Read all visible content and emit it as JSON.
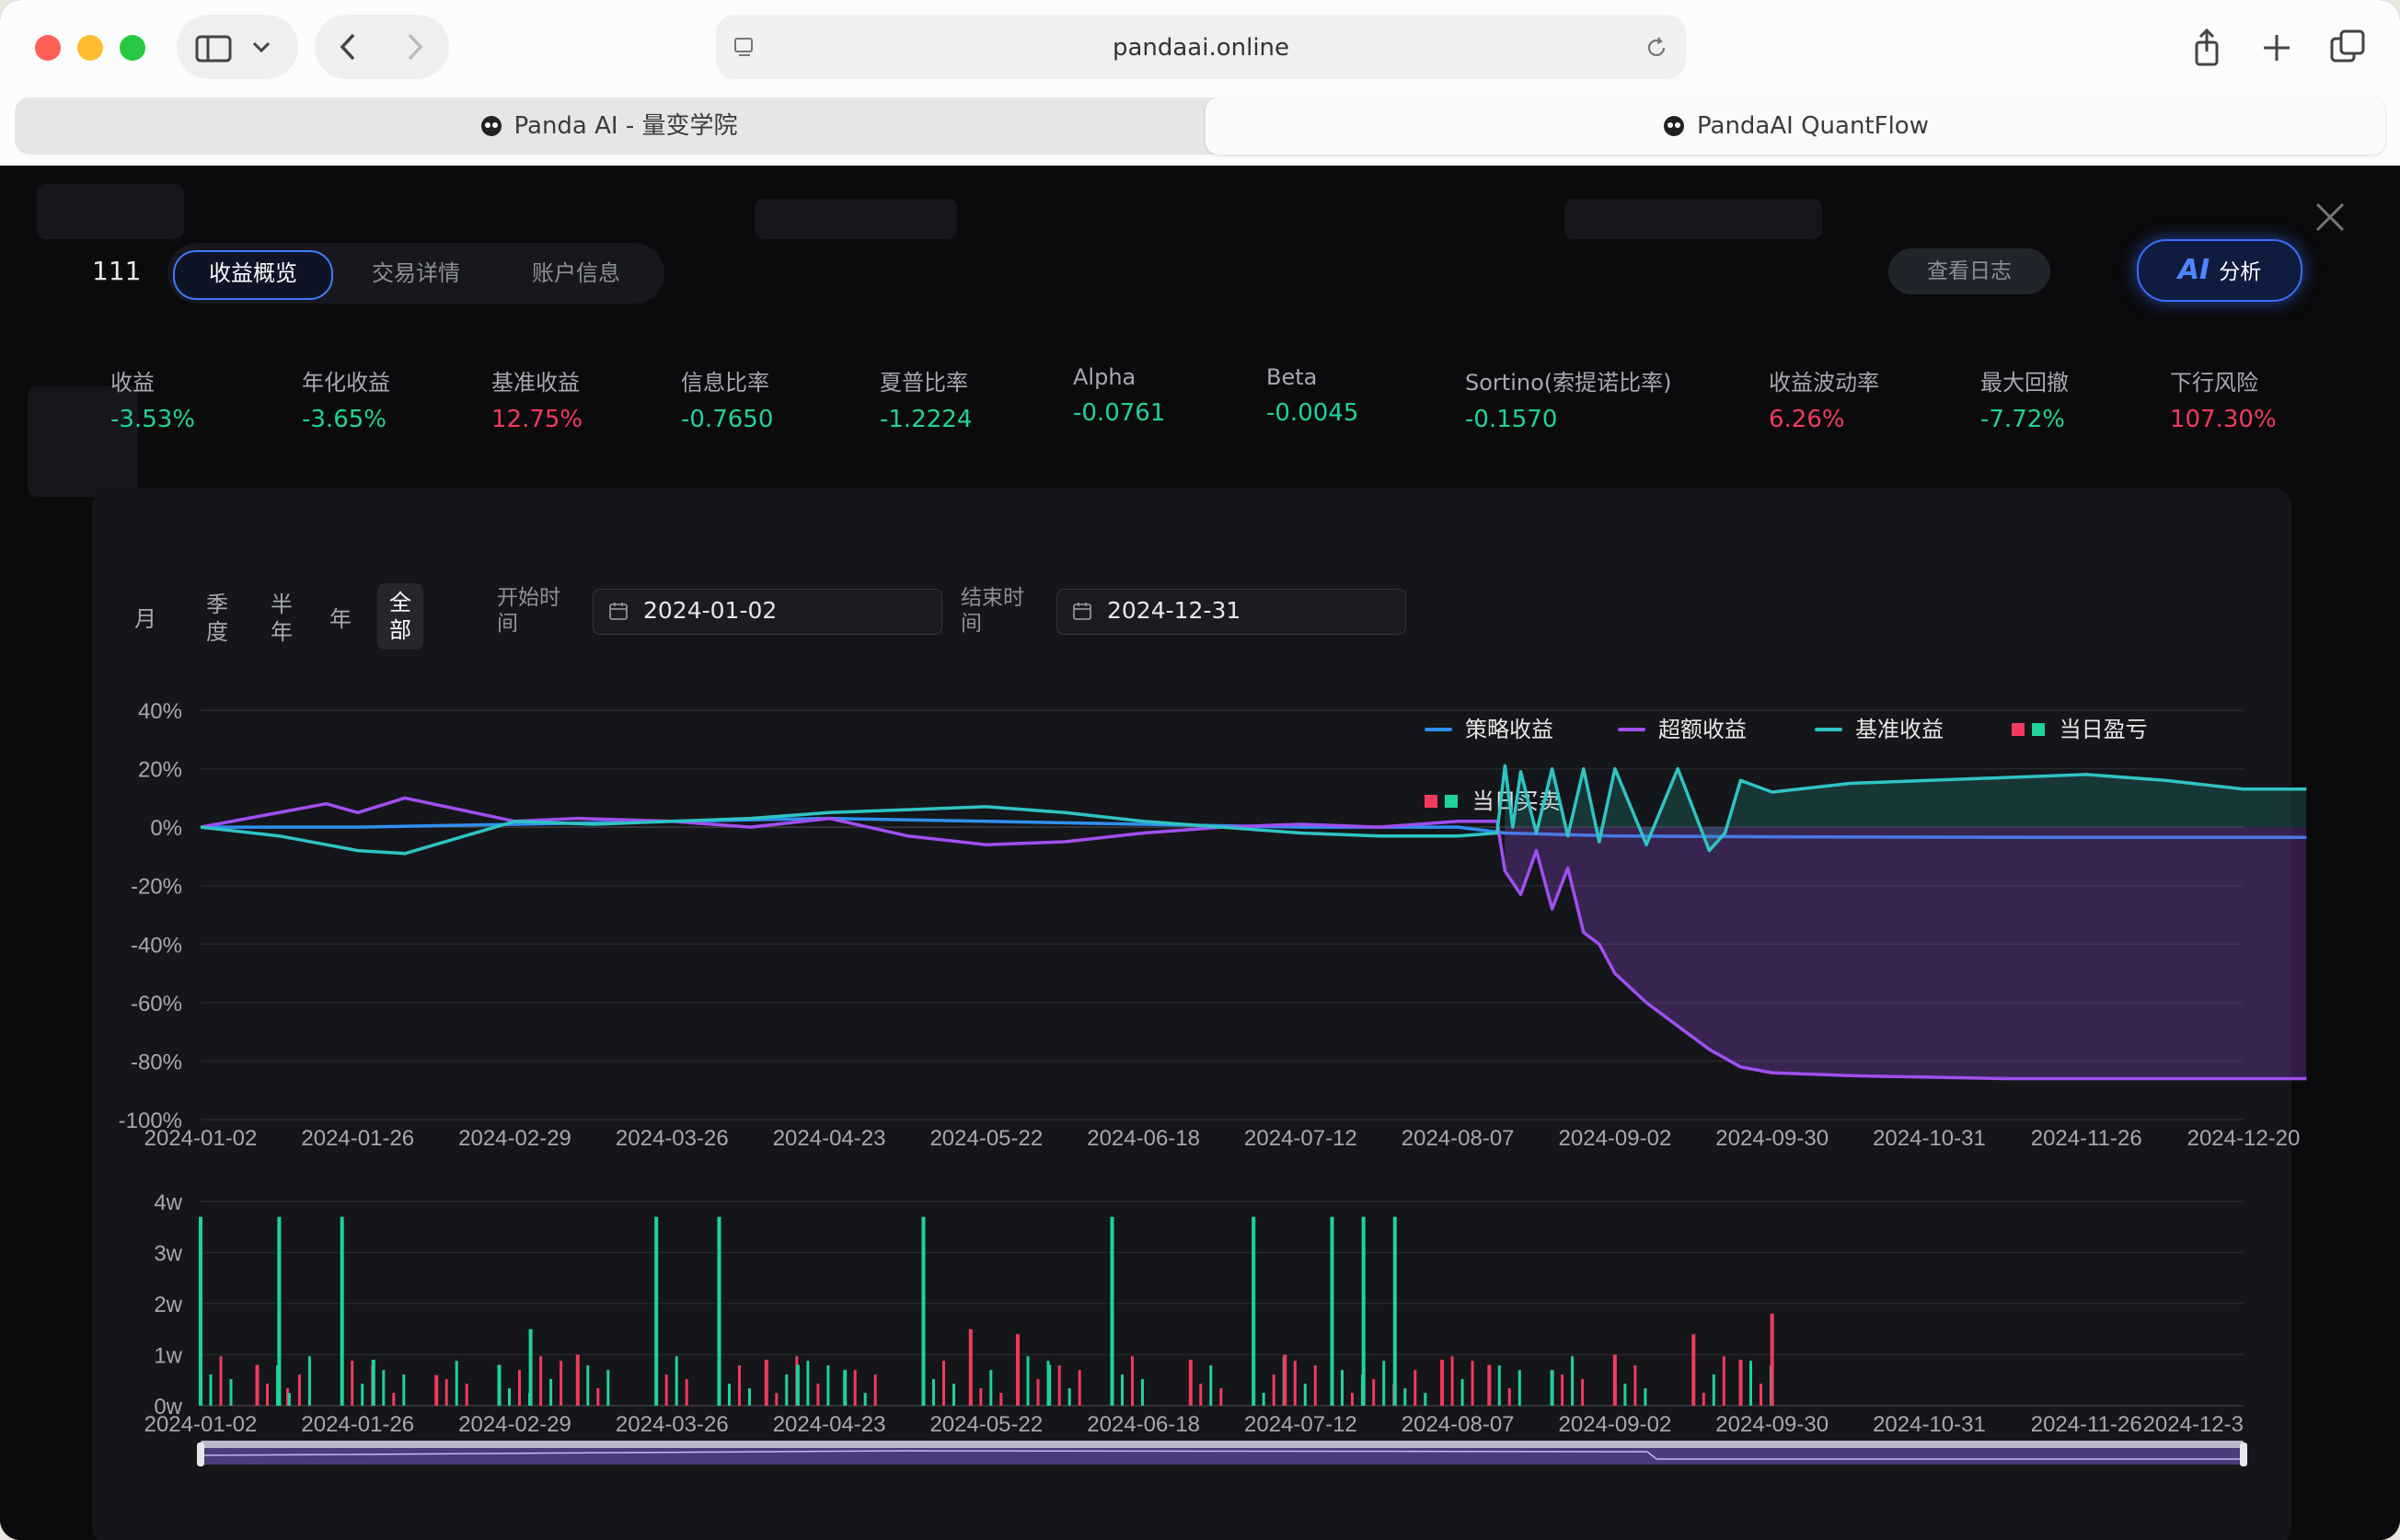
{
  "browser": {
    "url": "pandaai.online",
    "tabs": [
      {
        "label": "Panda AI - 量变学院",
        "active": false
      },
      {
        "label": "PandaAI QuantFlow",
        "active": true
      }
    ]
  },
  "header": {
    "name": "111",
    "tabs": [
      "收益概览",
      "交易详情",
      "账户信息"
    ],
    "active_tab": 0,
    "log_button": "查看日志",
    "ai_button": {
      "mark": "AI",
      "label": "分析"
    }
  },
  "metrics": [
    {
      "label": "收益",
      "value": "-3.53%",
      "tone": "green"
    },
    {
      "label": "年化收益",
      "value": "-3.65%",
      "tone": "green"
    },
    {
      "label": "基准收益",
      "value": "12.75%",
      "tone": "red"
    },
    {
      "label": "信息比率",
      "value": "-0.7650",
      "tone": "green"
    },
    {
      "label": "夏普比率",
      "value": "-1.2224",
      "tone": "green"
    },
    {
      "label": "Alpha",
      "value": "-0.0761",
      "tone": "green"
    },
    {
      "label": "Beta",
      "value": "-0.0045",
      "tone": "green"
    },
    {
      "label": "Sortino(索提诺比率)",
      "value": "-0.1570",
      "tone": "green"
    },
    {
      "label": "收益波动率",
      "value": "6.26%",
      "tone": "red"
    },
    {
      "label": "最大回撤",
      "value": "-7.72%",
      "tone": "green"
    },
    {
      "label": "下行风险",
      "value": "107.30%",
      "tone": "red"
    }
  ],
  "controls": {
    "periods": [
      "月",
      "季度",
      "半年",
      "年",
      "全部"
    ],
    "active_period": 4,
    "start_label": "开始时间",
    "start_date": "2024-01-02",
    "end_label": "结束时间",
    "end_date": "2024-12-31"
  },
  "legend": [
    {
      "name": "策略收益",
      "color": "#2f8ff0",
      "kind": "line"
    },
    {
      "name": "超额收益",
      "color": "#a04ff0",
      "kind": "line"
    },
    {
      "name": "基准收益",
      "color": "#2fc4c4",
      "kind": "line"
    },
    {
      "name": "当日盈亏",
      "colors": [
        "#f13a5d",
        "#1fd39a"
      ],
      "kind": "squares"
    },
    {
      "name": "当日买卖",
      "colors": [
        "#f13a5d",
        "#1fd39a"
      ],
      "kind": "squares"
    }
  ],
  "chart_data": [
    {
      "type": "line",
      "x_ticks": [
        "2024-01-02",
        "2024-01-26",
        "2024-02-29",
        "2024-03-26",
        "2024-04-23",
        "2024-05-22",
        "2024-06-18",
        "2024-07-12",
        "2024-08-07",
        "2024-09-02",
        "2024-09-30",
        "2024-10-31",
        "2024-11-26",
        "2024-12-20"
      ],
      "y_ticks": [
        "40%",
        "20%",
        "0%",
        "-20%",
        "-40%",
        "-60%",
        "-80%",
        "-100%"
      ],
      "ylim": [
        -100,
        40
      ],
      "series": [
        {
          "name": "策略收益",
          "color": "#2f8ff0",
          "x_index": [
            0,
            1,
            2,
            3,
            4,
            5,
            6,
            7,
            8,
            8.3,
            9,
            10,
            11,
            12,
            13.4
          ],
          "values": [
            0,
            0,
            1,
            2,
            3,
            2,
            1,
            0,
            0,
            -2,
            -3,
            -3.3,
            -3.4,
            -3.5,
            -3.5
          ]
        },
        {
          "name": "超额收益",
          "color": "#a04ff0",
          "x_index": [
            0,
            0.4,
            0.8,
            1.0,
            1.3,
            2,
            2.4,
            3,
            3.5,
            4,
            4.5,
            5,
            5.5,
            6,
            6.5,
            7,
            7.5,
            8,
            8.25,
            8.3,
            8.4,
            8.5,
            8.6,
            8.7,
            8.8,
            8.9,
            9,
            9.2,
            9.4,
            9.6,
            9.8,
            10,
            10.5,
            11,
            11.5,
            12,
            12.5,
            13,
            13.4
          ],
          "values": [
            0,
            4,
            8,
            5,
            10,
            2,
            3,
            2,
            0,
            3,
            -3,
            -6,
            -5,
            -2,
            0,
            1,
            0,
            2,
            2,
            -15,
            -23,
            -8,
            -28,
            -14,
            -36,
            -40,
            -50,
            -60,
            -68,
            -76,
            -82,
            -84,
            -85,
            -85.5,
            -86,
            -86,
            -86,
            -86,
            -86
          ]
        },
        {
          "name": "基准收益",
          "color": "#2fc4c4",
          "x_index": [
            0,
            0.5,
            0.8,
            1,
            1.3,
            2,
            2.5,
            3,
            3.5,
            4,
            4.5,
            5,
            5.5,
            6,
            6.5,
            7,
            7.5,
            8,
            8.25,
            8.3,
            8.35,
            8.4,
            8.5,
            8.6,
            8.7,
            8.8,
            8.9,
            9,
            9.2,
            9.4,
            9.6,
            9.7,
            9.8,
            10,
            10.5,
            11,
            11.5,
            12,
            12.5,
            13,
            13.4
          ],
          "values": [
            0,
            -3,
            -6,
            -8,
            -9,
            2,
            1,
            2,
            3,
            5,
            6,
            7,
            5,
            2,
            0,
            -2,
            -3,
            -3,
            -2,
            21,
            0,
            19,
            -2,
            20,
            -3,
            20,
            -5,
            20,
            -6,
            20,
            -8,
            -2,
            16,
            12,
            15,
            16,
            17,
            18,
            16,
            13,
            13
          ]
        }
      ]
    },
    {
      "type": "bar",
      "title": "",
      "x_ticks": [
        "2024-01-02",
        "2024-01-26",
        "2024-02-29",
        "2024-03-26",
        "2024-04-23",
        "2024-05-22",
        "2024-06-18",
        "2024-07-12",
        "2024-08-07",
        "2024-09-02",
        "2024-09-30",
        "2024-10-31",
        "2024-11-26",
        "2024-12-3"
      ],
      "y_ticks": [
        "4w",
        "3w",
        "2w",
        "1w",
        "0w"
      ],
      "ylim": [
        0,
        40000
      ],
      "series": [
        {
          "name": "当日买卖",
          "colors": [
            "#f13a5d",
            "#1fd39a"
          ],
          "x_index": [
            0,
            0.36,
            0.5,
            0.9,
            1.1,
            1.5,
            1.9,
            2.1,
            2.4,
            2.9,
            3.3,
            3.6,
            3.8,
            4.1,
            4.6,
            4.9,
            5.2,
            5.4,
            5.8,
            6.3,
            6.7,
            6.9,
            7.2,
            7.4,
            7.6,
            7.9,
            8.2,
            8.6,
            9.0,
            9.5,
            9.8,
            10.0
          ],
          "values": [
            37000,
            8000,
            37000,
            37000,
            9000,
            6000,
            8000,
            15000,
            10000,
            37000,
            37000,
            9000,
            8000,
            7000,
            37000,
            15000,
            14000,
            8000,
            37000,
            9000,
            37000,
            10000,
            37000,
            37000,
            37000,
            9000,
            8000,
            7000,
            10000,
            14000,
            9000,
            18000
          ],
          "signs": [
            1,
            -1,
            1,
            1,
            1,
            -1,
            1,
            1,
            -1,
            1,
            1,
            -1,
            1,
            1,
            1,
            -1,
            -1,
            1,
            1,
            -1,
            1,
            -1,
            1,
            1,
            1,
            -1,
            -1,
            1,
            -1,
            -1,
            -1,
            -1
          ]
        }
      ]
    }
  ]
}
